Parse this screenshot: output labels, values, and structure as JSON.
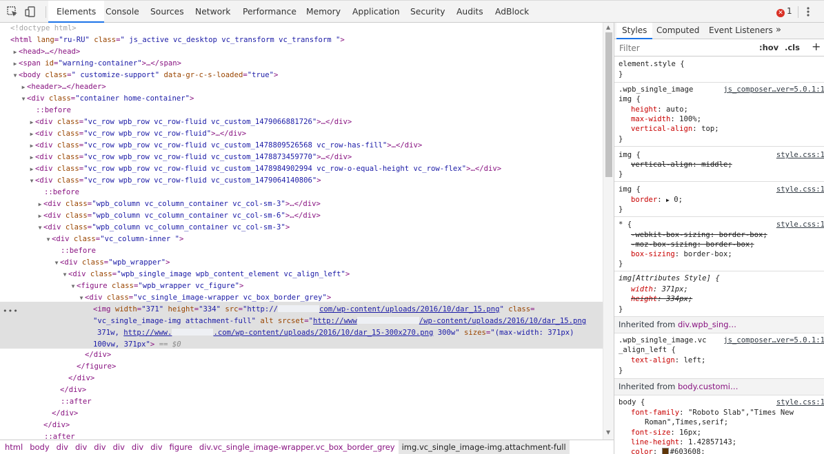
{
  "toolbar": {
    "tabs": [
      "Elements",
      "Console",
      "Sources",
      "Network",
      "Performance",
      "Memory",
      "Application",
      "Security",
      "Audits",
      "AdBlock"
    ],
    "error_count": "1"
  },
  "dom": {
    "l0": "<!doctype html>",
    "l1_tag": "<html",
    "l1_a1": "lang",
    "l1_v1": "\"ru-RU\"",
    "l1_a2": "class",
    "l1_v2": "\" js_active  vc_desktop  vc_transform  vc_transform \"",
    "l1_end": ">",
    "l2": "<head>…</head>",
    "l3_tag": "<span",
    "l3_a": "id",
    "l3_v": "\"warning-container\"",
    "l3_end": ">…</span>",
    "l4_tag": "<body",
    "l4_a1": "class",
    "l4_v1": "\" customize-support\"",
    "l4_a2": "data-gr-c-s-loaded",
    "l4_v2": "\"true\"",
    "l4_end": ">",
    "l5": "<header>…</header>",
    "l6_tag": "<div",
    "l6_a": "class",
    "l6_v": "\"container home-container\"",
    "l6_end": ">",
    "l7": "::before",
    "l8_v": "\"vc_row wpb_row vc_row-fluid vc_custom_1479066881726\"",
    "l9_v": "\"vc_row wpb_row vc_row-fluid\"",
    "l10_v": "\"vc_row wpb_row vc_row-fluid vc_custom_1478809526568 vc_row-has-fill\"",
    "l11_v": "\"vc_row wpb_row vc_row-fluid vc_custom_1478873459770\"",
    "l12_v": "\"vc_row wpb_row vc_row-fluid vc_custom_1478984902994 vc_row-o-equal-height vc_row-flex\"",
    "l13_v": "\"vc_row wpb_row vc_row-fluid vc_custom_1479064140806\"",
    "l14": "::before",
    "l15_v": "\"wpb_column vc_column_container vc_col-sm-3\"",
    "l16_v": "\"wpb_column vc_column_container vc_col-sm-6\"",
    "l17_v": "\"wpb_column vc_column_container vc_col-sm-3\"",
    "l18_v": "\"vc_column-inner \"",
    "l19": "::before",
    "l20_v": "\"wpb_wrapper\"",
    "l21_v": "\"wpb_single_image wpb_content_element vc_align_left\"",
    "l22_tag": "<figure",
    "l22_v": "\"wpb_wrapper vc_figure\"",
    "l23_v": "\"vc_single_image-wrapper   vc_box_border_grey\"",
    "div_tag": "<div",
    "class_attr": "class",
    "gt": ">",
    "collapsed_end": ">…</div>",
    "sel_tag": "<img",
    "sel_width_attr": "width",
    "sel_width": "\"371\"",
    "sel_height_attr": "height",
    "sel_height": "\"334\"",
    "sel_src_attr": "src",
    "sel_src_a": "\"http://",
    "sel_src_b": "com/wp-content/uploads/2016/10/dar_15.png",
    "sel_src_c": "\"",
    "sel_class_attr": "class",
    "sel_class_v": "\"vc_single_image-img attachment-full\"",
    "sel_alt_attr": "alt",
    "sel_srcset_attr": "srcset",
    "sel_srcset_a": "\"",
    "sel_srcset_link1a": "http://www",
    "sel_srcset_link1b": "/wp-content/uploads/2016/10/dar_15.png",
    "sel_srcset_b": "371w,",
    "sel_srcset_link2a": "http://www.",
    "sel_srcset_link2b": ".com/wp-content/uploads/2016/10/dar_15-300x270.png",
    "sel_srcset_c": "300w\"",
    "sel_sizes_attr": "sizes",
    "sel_sizes_a": "\"(max-width: 371px)",
    "sel_sizes_b": "100vw, 371px\"",
    "sel_end": ">",
    "sel_eq": "== $0",
    "close_div": "</div>",
    "close_figure": "</figure>",
    "after": "::after"
  },
  "breadcrumbs": [
    "html",
    "body",
    "div",
    "div",
    "div",
    "div",
    "div",
    "div",
    "figure",
    "div.vc_single_image-wrapper.vc_box_border_grey",
    "img.vc_single_image-img.attachment-full"
  ],
  "styles": {
    "tabs": [
      "Styles",
      "Computed",
      "Event Listeners"
    ],
    "filter_placeholder": "Filter",
    "hov": ":hov",
    "cls": ".cls",
    "element_style": "element.style {",
    "close_brace": "}",
    "r1_sel1": ".wpb_single_image",
    "r1_sel2": "img {",
    "r1_src": "js_composer…ver=5.0.1:1",
    "r1_p1": "height",
    "r1_v1": "auto;",
    "r1_p2": "max-width",
    "r1_v2": "100%;",
    "r1_p3": "vertical-align",
    "r1_v3": "top;",
    "r2_sel": "img {",
    "r2_src": "style.css:1",
    "r2_p1": "vertical-align",
    "r2_v1": "middle;",
    "r3_sel": "img {",
    "r3_src": "style.css:1",
    "r3_p1": "border",
    "r3_v1": "0;",
    "r4_sel": "* {",
    "r4_src": "style.css:1",
    "r4_p1": "-webkit-box-sizing",
    "r4_v1": "border-box;",
    "r4_p2": "-moz-box-sizing",
    "r4_v2": "border-box;",
    "r4_p3": "box-sizing",
    "r4_v3": "border-box;",
    "r5_sel": "img[Attributes Style] {",
    "r5_p1": "width",
    "r5_v1": "371px;",
    "r5_p2": "height",
    "r5_v2": "334px;",
    "inh1_label": "Inherited from ",
    "inh1_sel": "div.wpb_sing…",
    "r6_sel1": ".wpb_single_image.vc",
    "r6_sel2": "_align_left {",
    "r6_src": "js_composer…ver=5.0.1:1",
    "r6_p1": "text-align",
    "r6_v1": "left;",
    "inh2_label": "Inherited from ",
    "inh2_sel": "body.customi…",
    "r7_sel": "body {",
    "r7_src": "style.css:1",
    "r7_p1": "font-family",
    "r7_v1a": "\"Roboto Slab\",\"Times New",
    "r7_v1b": "Roman\",Times,serif;",
    "r7_p2": "font-size",
    "r7_v2": "16px;",
    "r7_p3": "line-height",
    "r7_v3": "1.42857143;",
    "r7_p4": "color",
    "r7_v4": "#603608;"
  }
}
